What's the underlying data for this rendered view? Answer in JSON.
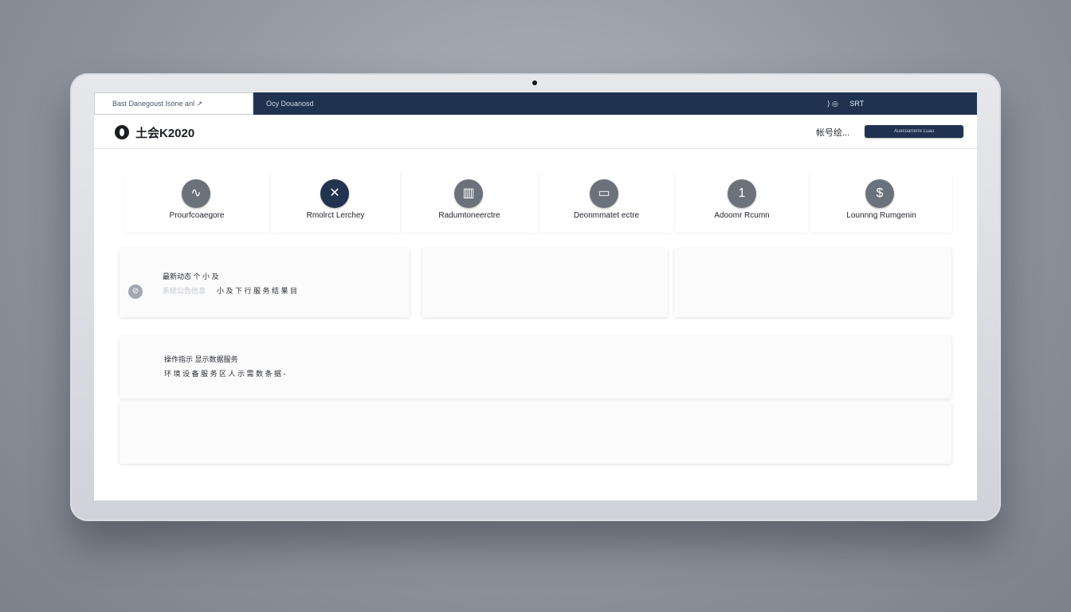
{
  "topbar": {
    "tab_label": "Bast Danegoust Isone anl",
    "tab_icon": "↗",
    "title": "Ocy Douanosd",
    "right_icons": "⟩ ◎",
    "right_label": "SRT"
  },
  "header": {
    "logo_text": "土会K2020",
    "link_label": "帐号绘...",
    "button_label": "Auecoarrerre Luau"
  },
  "categories": [
    {
      "label": "Prourfcoaegore",
      "icon": "chart-line-icon"
    },
    {
      "label": "Rmolrct Lerchey",
      "icon": "tools-icon"
    },
    {
      "label": "Radumtoneerctre",
      "icon": "building-icon"
    },
    {
      "label": "Deonmmatet ectre",
      "icon": "monitor-icon"
    },
    {
      "label": "Adoomr Rcumn",
      "icon": "number-icon"
    },
    {
      "label": "Lounnng Rumgenin",
      "icon": "hand-icon"
    }
  ],
  "card1": {
    "line1": "最新动态 个 小 及",
    "line2_faint": "系统公告信息",
    "line2": "小 及 下 行 服 务 结 果 目"
  },
  "card4": {
    "line1": "操作指示 显示数据服务",
    "line2": "环 境 设 备 服 务 区 人 示 需 数 条 据 -"
  },
  "icons": {
    "category_1": "∿",
    "category_2": "✕",
    "category_3": "▥",
    "category_4": "▭",
    "category_5": "1",
    "category_6": "$",
    "card1": "⊘"
  }
}
